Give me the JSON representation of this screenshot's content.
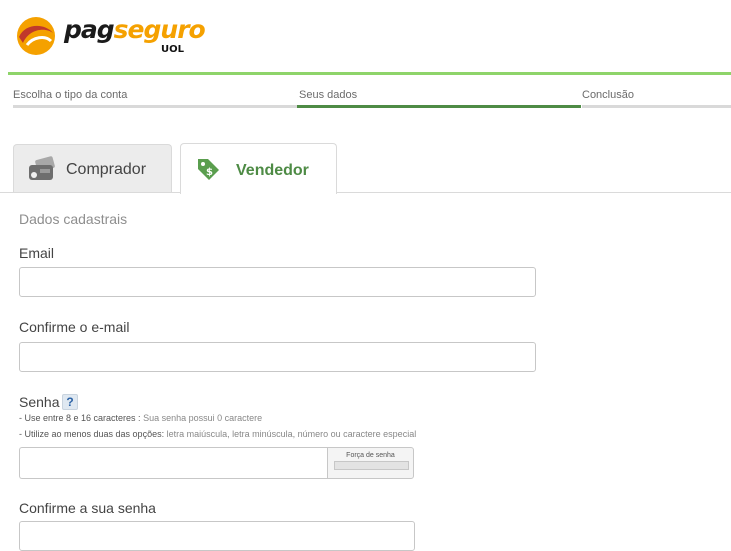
{
  "brand": {
    "pag": "pag",
    "seguro": "seguro",
    "uol": "UOL",
    "accent": "#8ed46a",
    "logo_color": "#f5a100"
  },
  "steps": [
    {
      "label": "Escolha o tipo da conta",
      "active": false
    },
    {
      "label": "Seus dados",
      "active": true
    },
    {
      "label": "Conclusão",
      "active": false
    }
  ],
  "tabs": [
    {
      "label": "Comprador",
      "icon": "wallet-icon",
      "selected": false
    },
    {
      "label": "Vendedor",
      "icon": "price-tag-icon",
      "selected": true
    }
  ],
  "form": {
    "section_title": "Dados cadastrais",
    "email": {
      "label": "Email",
      "value": ""
    },
    "email_confirm": {
      "label": "Confirme o e-mail",
      "value": ""
    },
    "password": {
      "label": "Senha",
      "help": "?",
      "hint1_strong": "- Use entre 8 e 16 caracteres :",
      "hint1_light": " Sua senha possui 0 caractere",
      "hint2_strong": "- Utilize ao menos duas das opções:",
      "hint2_light": " letra maiúscula, letra minúscula, número ou caractere especial",
      "strength_label": "Força de senha",
      "strength": 0,
      "value": ""
    },
    "password_confirm": {
      "label": "Confirme a sua senha",
      "value": ""
    }
  }
}
